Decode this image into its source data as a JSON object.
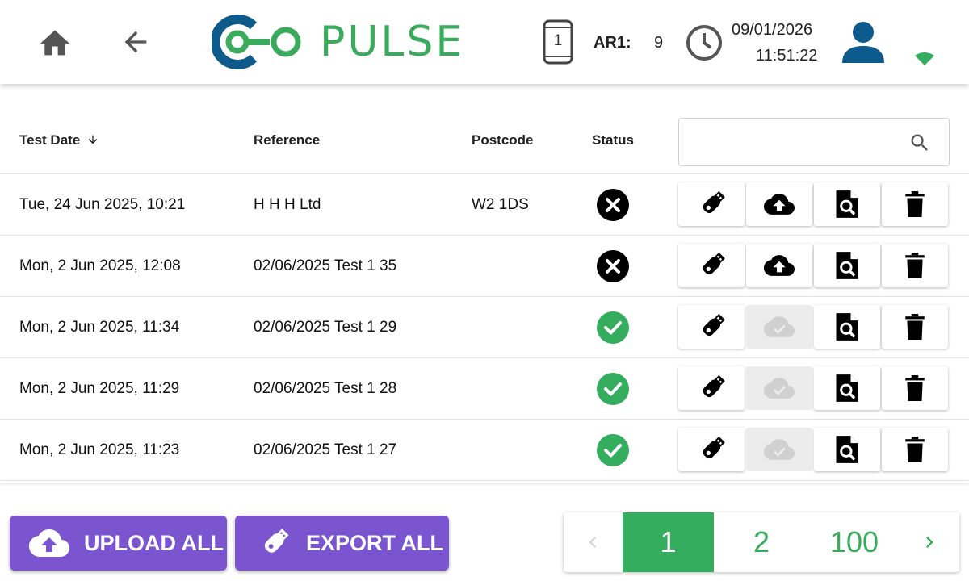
{
  "header": {
    "brand": "PULSE",
    "device_count": "1",
    "ar_label": "AR1:",
    "ar_value": "9",
    "date": "09/01/2026",
    "time": "11:51:22",
    "icons": [
      "home-icon",
      "back-arrow-icon",
      "device-icon",
      "clock-icon",
      "user-icon",
      "wifi-icon"
    ]
  },
  "colors": {
    "brand_green": "#3aaa5c",
    "brand_blue": "#0e5a8a",
    "user_blue": "#0d5b8c",
    "purple": "#7b55d0",
    "status_ok": "#35ad5e",
    "status_fail": "#000000"
  },
  "table": {
    "columns": [
      "Test Date",
      "Reference",
      "Postcode",
      "Status"
    ],
    "search_placeholder": "",
    "rows": [
      {
        "date": "Tue, 24 Jun 2025, 10:21",
        "reference": "H H H Ltd",
        "postcode": "W2 1DS",
        "status": "fail",
        "uploadable": true
      },
      {
        "date": "Mon, 2 Jun 2025, 12:08",
        "reference": "02/06/2025 Test 1 35",
        "postcode": "",
        "status": "fail",
        "uploadable": true
      },
      {
        "date": "Mon, 2 Jun 2025, 11:34",
        "reference": "02/06/2025 Test 1 29",
        "postcode": "",
        "status": "pass",
        "uploadable": false
      },
      {
        "date": "Mon, 2 Jun 2025, 11:29",
        "reference": "02/06/2025 Test 1 28",
        "postcode": "",
        "status": "pass",
        "uploadable": false
      },
      {
        "date": "Mon, 2 Jun 2025, 11:23",
        "reference": "02/06/2025 Test 1 27",
        "postcode": "",
        "status": "pass",
        "uploadable": false
      }
    ]
  },
  "footer": {
    "upload_all": "UPLOAD ALL",
    "export_all": "EXPORT ALL",
    "pages": [
      "1",
      "2",
      "100"
    ],
    "current_page": "1"
  }
}
